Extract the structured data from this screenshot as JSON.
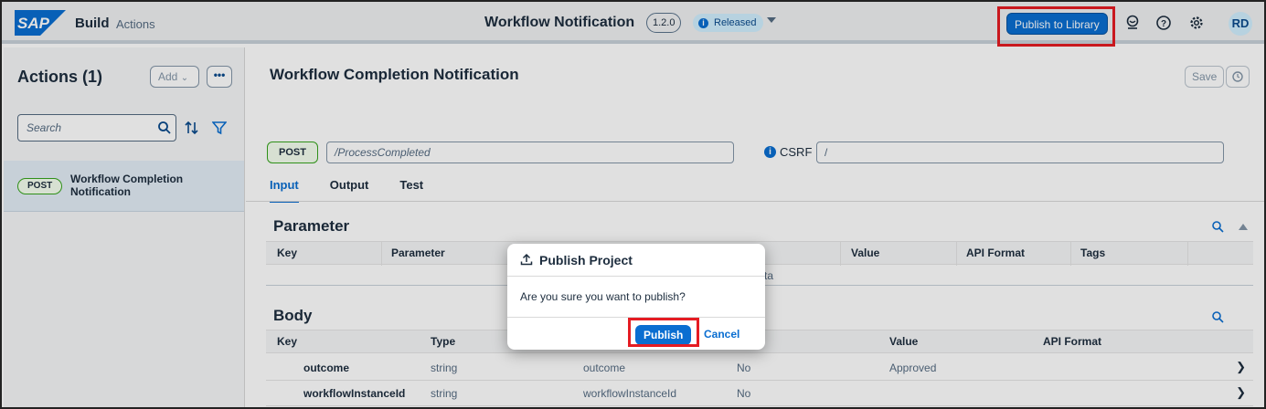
{
  "shell": {
    "logo_text": "SAP",
    "title": "Build",
    "subtitle": "Actions",
    "center_title": "Workflow Notification",
    "version": "1.2.0",
    "status": "Released",
    "publish_library_label": "Publish to Library",
    "avatar_initials": "RD",
    "icons": [
      "help-feedback-icon",
      "question-icon",
      "gear-icon"
    ]
  },
  "left": {
    "title": "Actions (1)",
    "add_label": "Add",
    "more_label": "•••",
    "search_placeholder": "Search",
    "items": [
      {
        "method": "POST",
        "label": "Workflow Completion Notification"
      }
    ]
  },
  "main": {
    "title": "Workflow Completion Notification",
    "save_label": "Save",
    "method": "POST",
    "path": "/ProcessCompleted",
    "csrf_label": "CSRF",
    "csrf_value": "/",
    "tabs": [
      "Input",
      "Output",
      "Test"
    ],
    "active_tab": "Input",
    "parameter": {
      "title": "Parameter",
      "columns": [
        "Key",
        "Parameter",
        "Value",
        "API Format",
        "Tags"
      ],
      "row_fragment": "ta"
    },
    "body": {
      "title": "Body",
      "columns": [
        "Key",
        "Type",
        "Value",
        "API Format"
      ],
      "rows": [
        {
          "key": "outcome",
          "type": "string",
          "label": "outcome",
          "mandatory": "No",
          "value": "Approved"
        },
        {
          "key": "workflowInstanceId",
          "type": "string",
          "label": "workflowInstanceId",
          "mandatory": "No",
          "value": ""
        }
      ]
    }
  },
  "dialog": {
    "title": "Publish Project",
    "message": "Are you sure you want to publish?",
    "publish_label": "Publish",
    "cancel_label": "Cancel"
  },
  "colors": {
    "accent": "#0a6ed1",
    "highlight": "#e51c23",
    "post_badge_border": "#36a41d"
  }
}
